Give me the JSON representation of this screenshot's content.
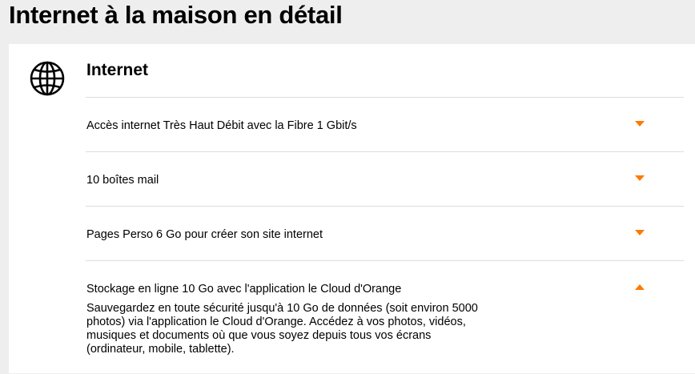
{
  "page": {
    "title": "Internet à la maison en détail"
  },
  "section": {
    "icon": "globe-icon",
    "title": "Internet"
  },
  "accent_color": "#ff7900",
  "items": [
    {
      "label": "Accès internet Très Haut Débit avec la Fibre 1 Gbit/s",
      "expanded": false
    },
    {
      "label": "10 boîtes mail",
      "expanded": false
    },
    {
      "label": "Pages Perso 6 Go pour créer son site internet",
      "expanded": false
    },
    {
      "label": "Stockage en ligne 10 Go avec l'application le Cloud d'Orange",
      "expanded": true,
      "description": "Sauvegardez en toute sécurité jusqu'à 10 Go de données (soit environ 5000 photos) via l'application le Cloud d'Orange. Accédez à vos photos, vidéos, musiques et documents où que vous soyez depuis tous vos écrans (ordinateur, mobile, tablette)."
    }
  ]
}
